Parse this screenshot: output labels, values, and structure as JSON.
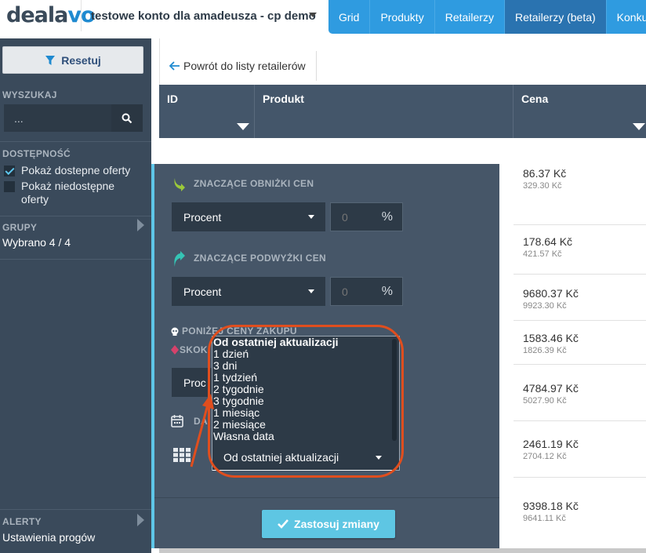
{
  "header": {
    "logo_main": "deala",
    "logo_accent": "vo",
    "account_name": "testowe konto dla amadeusza - cp demo",
    "tabs": [
      {
        "label": "Grid"
      },
      {
        "label": "Produkty"
      },
      {
        "label": "Retailerzy"
      },
      {
        "label": "Retailerzy (beta)",
        "active": true
      },
      {
        "label": "Konkur"
      }
    ]
  },
  "sidebar": {
    "reset_label": "Resetuj",
    "search_label": "WYSZUKAJ",
    "search_placeholder": "...",
    "availability_label": "DOSTĘPNOŚĆ",
    "show_available": "Pokaż dostepne oferty",
    "show_unavailable": "Pokaż niedostępne oferty",
    "groups_label": "GRUPY",
    "groups_value": "Wybrano 4 / 4",
    "alerts_label": "ALERTY",
    "alerts_value": "Ustawienia progów"
  },
  "toolbar": {
    "back_label": "Powrót do listy retailerów"
  },
  "table": {
    "columns": [
      "ID",
      "Produkt",
      "Cena"
    ],
    "rows": [
      {
        "price": "86.37 Kč",
        "prev_price": "329.30 Kč"
      },
      {
        "price": "178.64 Kč",
        "prev_price": "421.57 Kč"
      },
      {
        "price": "9680.37 Kč",
        "prev_price": "9923.30 Kč"
      },
      {
        "price": "1583.46 Kč",
        "prev_price": "1826.39 Kč"
      },
      {
        "price": "4784.97 Kč",
        "prev_price": "5027.90 Kč"
      },
      {
        "price": "2461.19 Kč",
        "prev_price": "2704.12 Kč"
      },
      {
        "price": "9398.18 Kč",
        "prev_price": "9641.11 Kč"
      }
    ]
  },
  "filter_panel": {
    "drops_label": "ZNACZĄCE OBNIŻKI CEN",
    "drops_mode": "Procent",
    "drops_value": "0",
    "drops_unit": "%",
    "raises_label": "ZNACZĄCE PODWYŻKI CEN",
    "raises_mode": "Procent",
    "raises_value": "0",
    "raises_unit": "%",
    "below_purchase_label": "PONIŻEJ CENY ZAKUPU",
    "jumps_label": "SKOK",
    "jumps_mode_partial": "Proc",
    "date_label_partial": "DA",
    "apply_label": "Zastosuj zmiany",
    "date_dropdown": {
      "options": [
        "Od ostatniej aktualizacji",
        "1 dzień",
        "3 dni",
        "1 tydzień",
        "2 tygodnie",
        "3 tygodnie",
        "1 miesiąc",
        "2 miesiące",
        "Własna data"
      ],
      "selected": "Od ostatniej aktualizacji"
    }
  },
  "colors": {
    "nav_blue": "#2f9be0",
    "nav_active": "#2a73b0",
    "sidebar_bg": "#3a4a5b",
    "panel_bg": "#465668",
    "accent_cyan": "#5ec6e3",
    "highlight_red": "#e04e1e",
    "drop_icon_green": "#9bc93a",
    "raise_icon_teal": "#35c4b5"
  }
}
